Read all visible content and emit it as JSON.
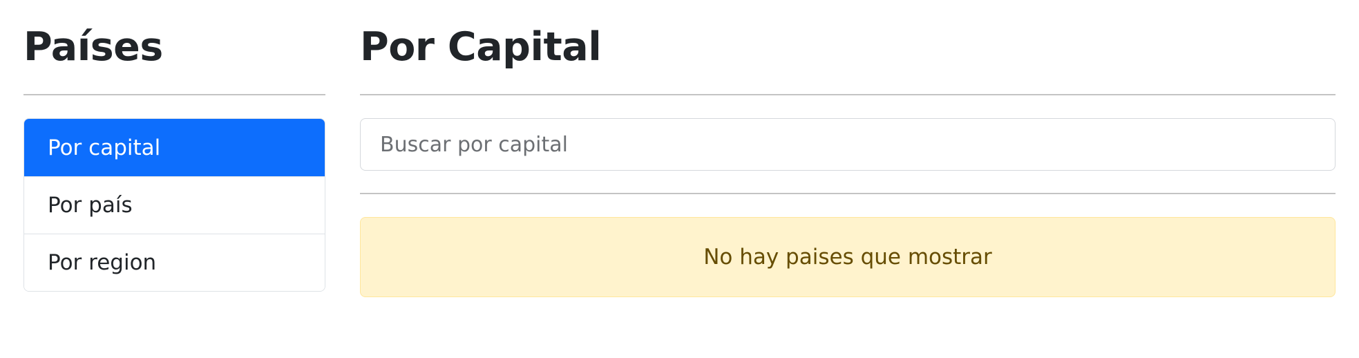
{
  "sidebar": {
    "title": "Países",
    "items": [
      {
        "label": "Por capital",
        "active": true
      },
      {
        "label": "Por país",
        "active": false
      },
      {
        "label": "Por region",
        "active": false
      }
    ]
  },
  "main": {
    "title": "Por Capital",
    "search": {
      "placeholder": "Buscar por capital",
      "value": ""
    },
    "alert": {
      "message": "No hay paises que mostrar"
    }
  },
  "colors": {
    "active": "#0d6efd",
    "alert_background": "#fff3cd",
    "alert_text": "#664d03"
  }
}
